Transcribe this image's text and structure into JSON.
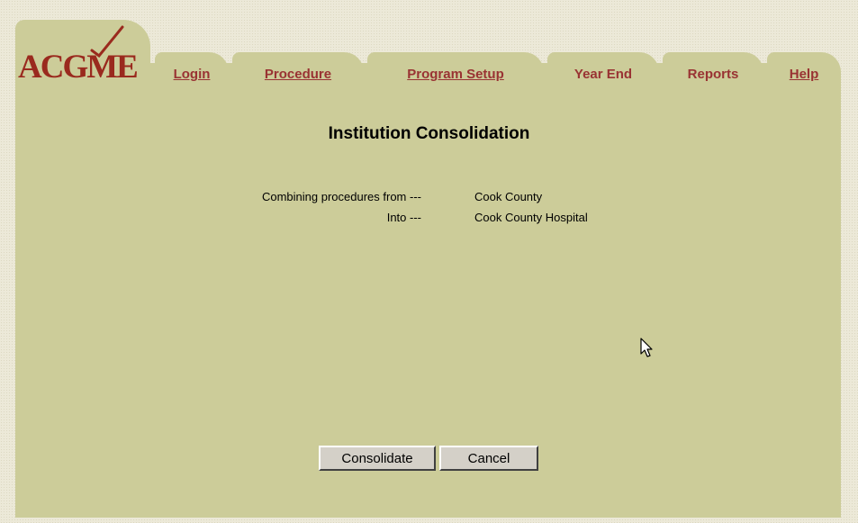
{
  "logo": {
    "text": "ACGME"
  },
  "nav": {
    "login": "Login",
    "procedure": "Procedure",
    "program_setup": "Program Setup",
    "year_end": "Year End",
    "reports": "Reports",
    "help": "Help"
  },
  "page": {
    "title": "Institution Consolidation"
  },
  "consolidation": {
    "from_label": "Combining procedures from ---",
    "from_value": "Cook County",
    "into_label": "Into ---",
    "into_value": "Cook County Hospital"
  },
  "buttons": {
    "consolidate": "Consolidate",
    "cancel": "Cancel"
  },
  "colors": {
    "panel": "#cccc99",
    "tab_text": "#993333",
    "logo": "#9a2a1e"
  }
}
